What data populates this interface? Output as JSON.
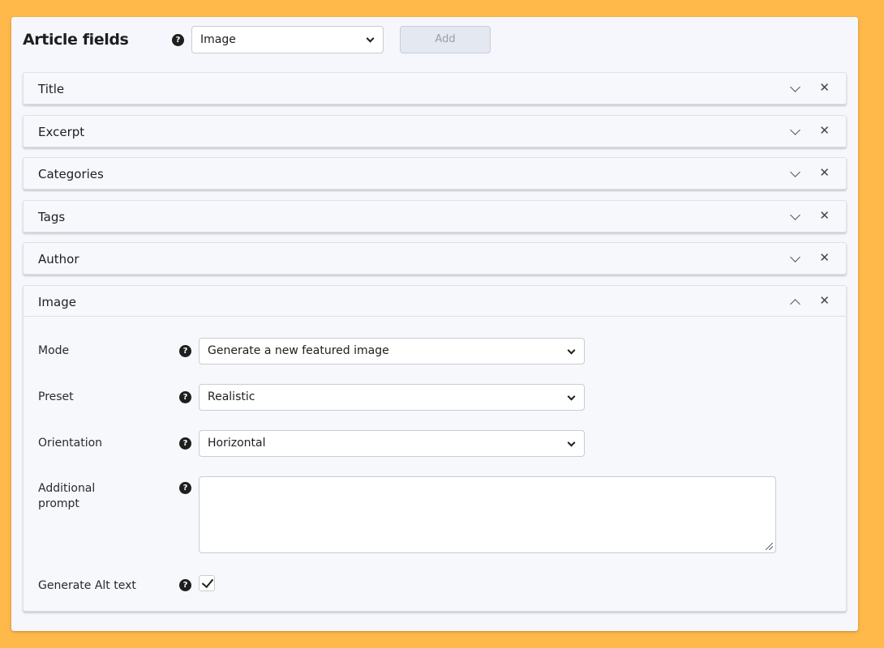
{
  "header": {
    "title": "Article fields",
    "help_icon": "question-circle-icon",
    "field_type_select": {
      "selected": "Image"
    },
    "add_button": "Add"
  },
  "rows": [
    {
      "label": "Title",
      "expanded": false
    },
    {
      "label": "Excerpt",
      "expanded": false
    },
    {
      "label": "Categories",
      "expanded": false
    },
    {
      "label": "Tags",
      "expanded": false
    },
    {
      "label": "Author",
      "expanded": false
    },
    {
      "label": "Image",
      "expanded": true
    }
  ],
  "image_settings": {
    "mode": {
      "label": "Mode",
      "value": "Generate a new featured image"
    },
    "preset": {
      "label": "Preset",
      "value": "Realistic"
    },
    "orientation": {
      "label": "Orientation",
      "value": "Horizontal"
    },
    "additional_prompt": {
      "label_line1": "Additional",
      "label_line2": "prompt",
      "value": ""
    },
    "generate_alt_text": {
      "label": "Generate Alt text",
      "checked": true
    }
  },
  "colors": {
    "page_background": "#ffb94a",
    "panel_background": "#f5f7fc",
    "text": "#1e1e1e"
  }
}
